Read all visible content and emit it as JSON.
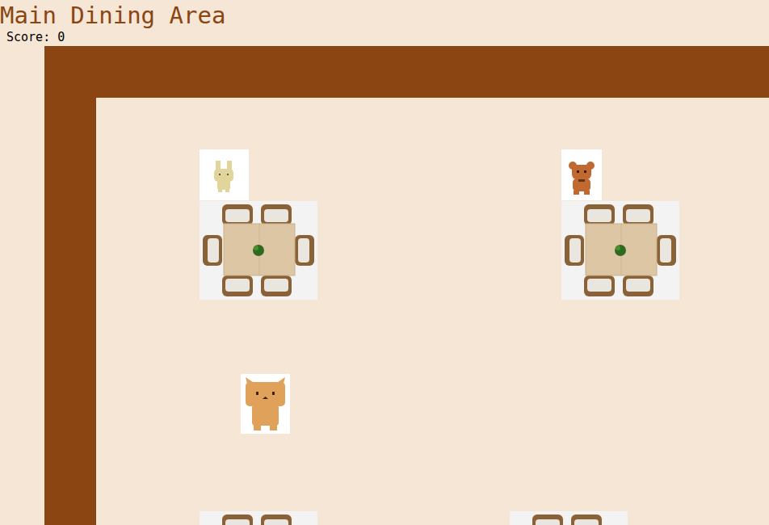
{
  "title": "Main Dining Area",
  "score": "Score: 0"
}
